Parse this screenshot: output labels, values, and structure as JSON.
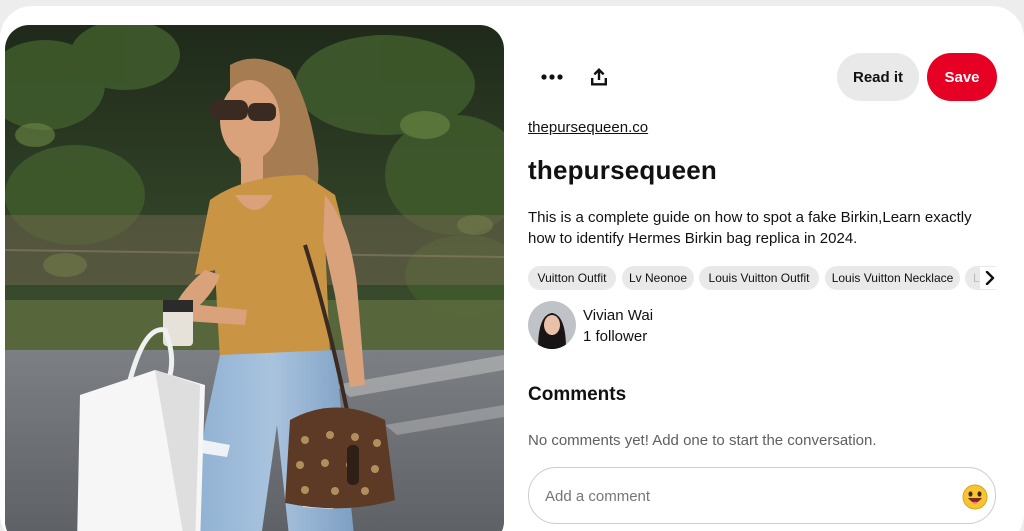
{
  "pin": {
    "image_alt": "Woman in sunglasses carrying a shopping bag and a monogram bucket bag",
    "more_icon": "more-horizontal-icon",
    "share_icon": "share-upload-icon",
    "read_label": "Read it",
    "save_label": "Save",
    "source_link": "thepursequeen.co",
    "title": "thepursequeen",
    "description": "This is a complete guide on how to spot a fake Birkin,Learn exactly how to identify Hermes Birkin bag replica in 2024."
  },
  "tags": [
    "Vuitton Outfit",
    "Lv Neonoe",
    "Louis Vuitton Outfit",
    "Louis Vuitton Necklace",
    "L"
  ],
  "tags_next_icon": "chevron-right-icon",
  "author": {
    "name": "Vivian Wai",
    "followers": "1 follower"
  },
  "comments": {
    "heading": "Comments",
    "empty_text": "No comments yet! Add one to start the conversation.",
    "placeholder": "Add a comment",
    "emoji_icon": "emoji-picker-icon"
  },
  "colors": {
    "save_button": "#e60023",
    "chip_background": "#e9e9e9"
  }
}
